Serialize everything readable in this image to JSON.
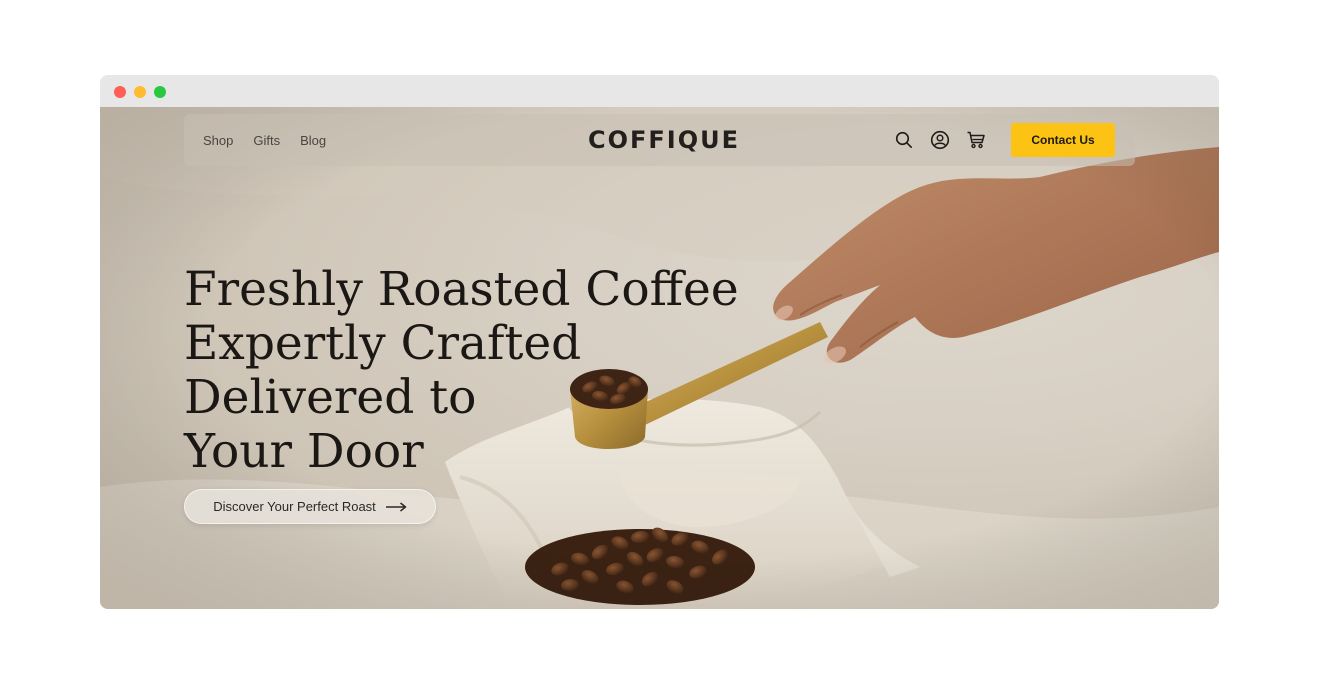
{
  "browser": {
    "controls": [
      "close",
      "minimize",
      "maximize"
    ]
  },
  "nav": {
    "links": [
      "Shop",
      "Gifts",
      "Blog"
    ],
    "logo": "COFFIQUE",
    "icons": [
      "search-icon",
      "user-icon",
      "cart-icon"
    ],
    "contact_label": "Contact Us"
  },
  "hero": {
    "headline_lines": [
      "Freshly Roasted Coffee",
      "Expertly Crafted",
      "Delivered to",
      "Your Door"
    ],
    "cta_label": "Discover Your Perfect Roast",
    "cta_icon": "arrow-right-icon"
  },
  "colors": {
    "accent": "#fcc314",
    "text_dark": "#1a1714",
    "hero_bg": "#d8d0c4",
    "titlebar": "#e7e7e7"
  }
}
